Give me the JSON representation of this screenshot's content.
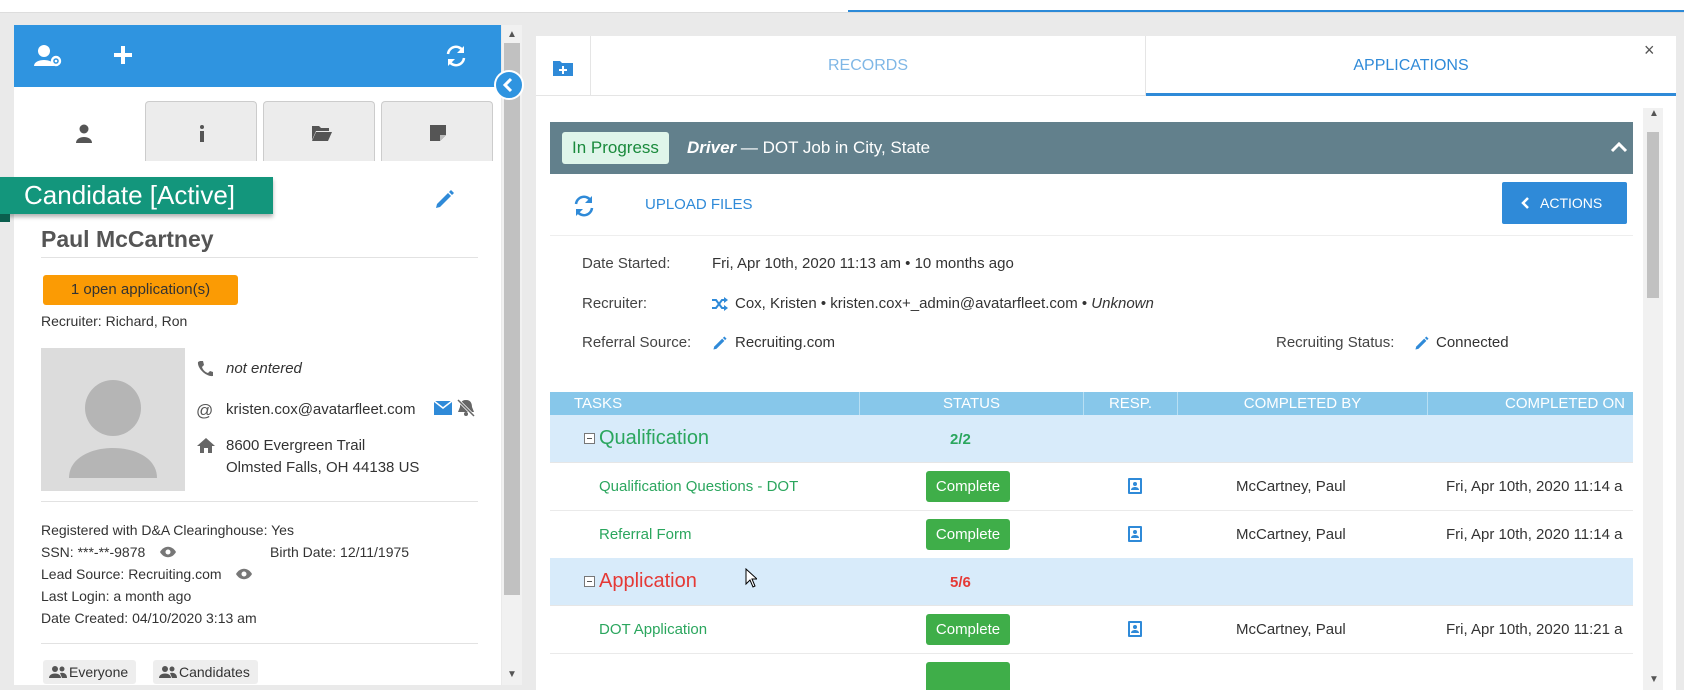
{
  "colors": {
    "primary": "#2f94e0",
    "status_active": "#13967c",
    "open_apps": "#fb9b04",
    "complete": "#3fae49",
    "qualification": "#2ba65e",
    "application": "#e53935",
    "header_bar": "#62808c",
    "table_head": "#87c7ea"
  },
  "left": {
    "header_icons": [
      "user-gear-icon",
      "plus-icon",
      "refresh-icon"
    ],
    "tab_icons": [
      "user-icon",
      "info-icon",
      "folder-open-icon",
      "note-icon"
    ],
    "status": "Candidate [Active]",
    "name": "Paul McCartney",
    "open_apps": "1 open application(s)",
    "recruiter_label": "Recruiter:",
    "recruiter_value": "Richard, Ron",
    "phone": "not entered",
    "email": "kristen.cox@avatarfleet.com",
    "address_line1": "8600 Evergreen Trail",
    "address_line2": "Olmsted Falls, OH 44138 US",
    "clearinghouse_label": "Registered with D&A Clearinghouse:",
    "clearinghouse_value": "Yes",
    "ssn_label": "SSN:",
    "ssn_value": "***-**-9878",
    "birth_label": "Birth Date:",
    "birth_value": "12/11/1975",
    "lead_label": "Lead Source:",
    "lead_value": "Recruiting.com",
    "login_label": "Last Login:",
    "login_value": "a month ago",
    "created_label": "Date Created:",
    "created_value": "04/10/2020 3:13 am",
    "chips": [
      "Everyone",
      "Candidates"
    ]
  },
  "right": {
    "tabs": {
      "records": "RECORDS",
      "applications": "APPLICATIONS"
    },
    "close": "×",
    "app": {
      "status": "In Progress",
      "job_role": "Driver",
      "job_rest": " — DOT Job in City, State",
      "upload": "UPLOAD FILES",
      "actions": "ACTIONS",
      "date_started_label": "Date Started:",
      "date_started_value": "Fri, Apr 10th, 2020 11:13 am • 10 months ago",
      "recruiter_label": "Recruiter:",
      "recruiter_value": "Cox, Kristen • kristen.cox+_admin@avatarfleet.com •",
      "recruiter_unknown": "Unknown",
      "referral_label": "Referral Source:",
      "referral_value": "Recruiting.com",
      "recruiting_status_label": "Recruiting Status:",
      "recruiting_status_value": "Connected"
    },
    "table": {
      "headers": [
        "TASKS",
        "STATUS",
        "RESP.",
        "COMPLETED BY",
        "COMPLETED ON"
      ],
      "groups": [
        {
          "name": "Qualification",
          "count": "2/2",
          "tasks": [
            {
              "name": "Qualification Questions - DOT",
              "status": "Complete",
              "by": "McCartney, Paul",
              "on": "Fri, Apr 10th, 2020 11:14 a"
            },
            {
              "name": "Referral Form",
              "status": "Complete",
              "by": "McCartney, Paul",
              "on": "Fri, Apr 10th, 2020 11:14 a"
            }
          ]
        },
        {
          "name": "Application",
          "count": "5/6",
          "tasks": [
            {
              "name": "DOT Application",
              "status": "Complete",
              "by": "McCartney, Paul",
              "on": "Fri, Apr 10th, 2020 11:21 a"
            }
          ]
        }
      ]
    }
  }
}
